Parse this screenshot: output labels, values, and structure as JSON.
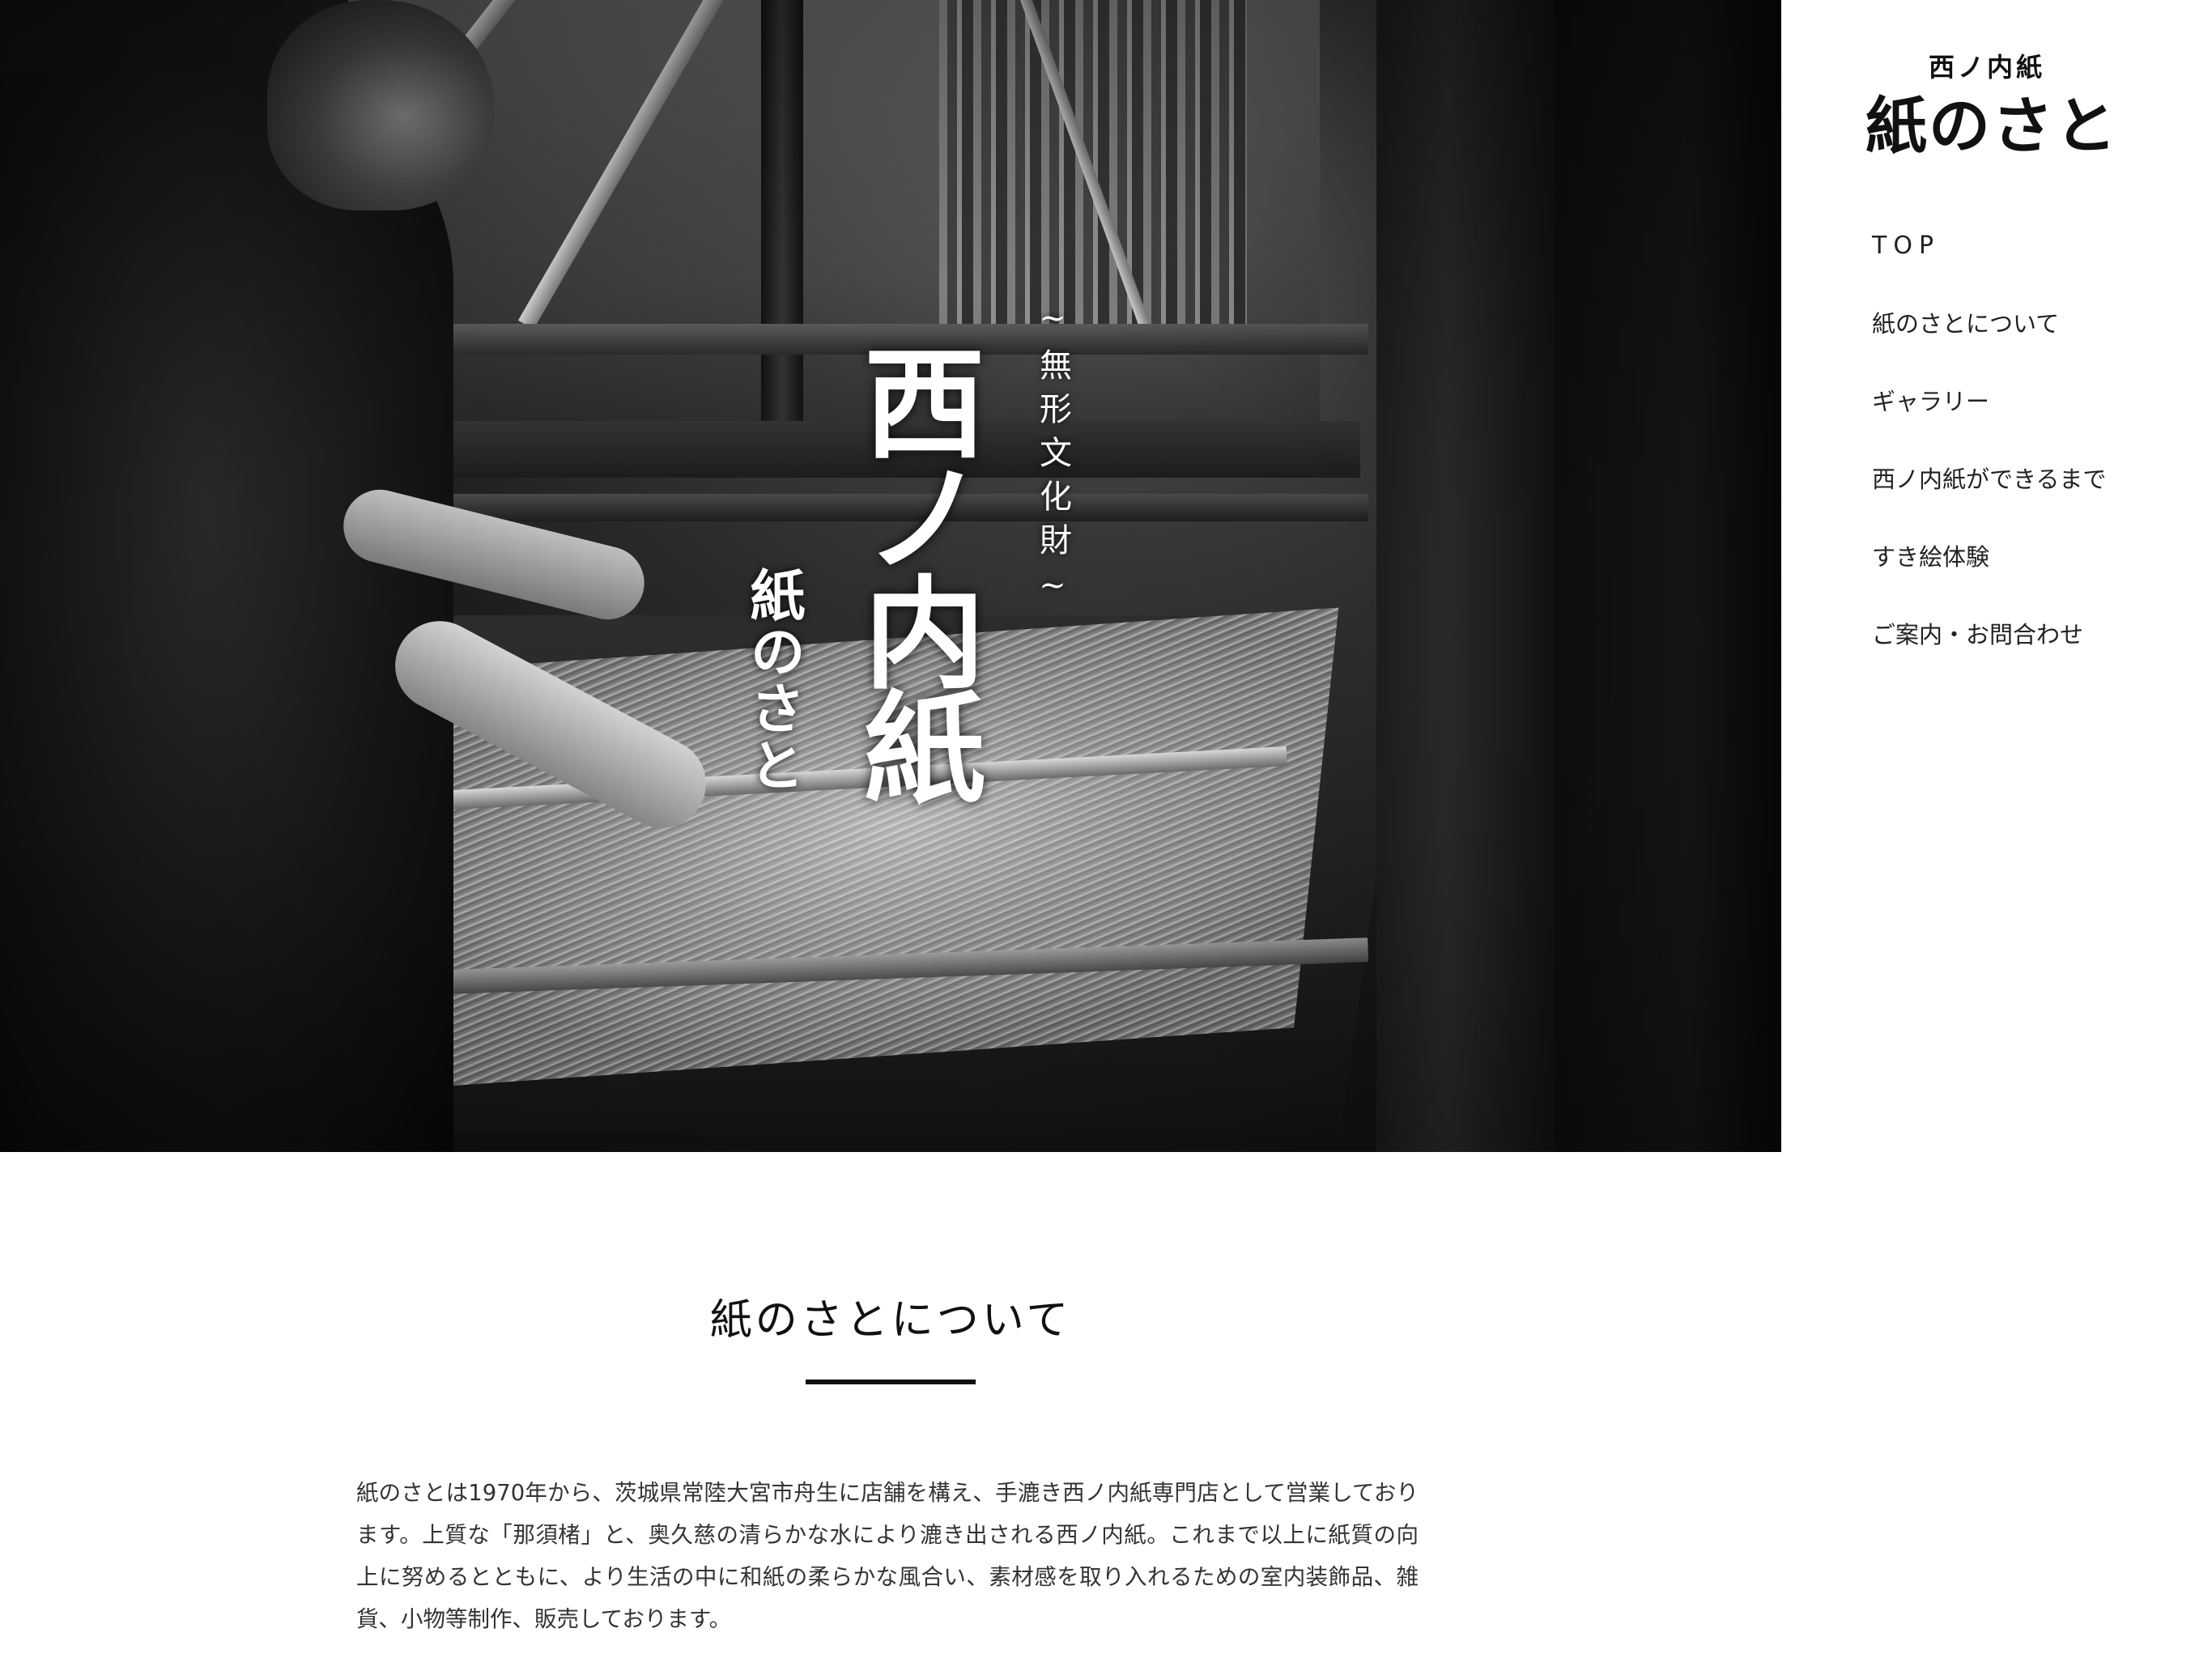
{
  "hero": {
    "subtitle": "~無形文化財~",
    "title": "西ノ内紙",
    "tagline": "紙のさと"
  },
  "logo": {
    "top_text": "西ノ内紙",
    "main_text": "紙のさと"
  },
  "nav": {
    "items": [
      {
        "label": "TOP"
      },
      {
        "label": "紙のさとについて"
      },
      {
        "label": "ギャラリー"
      },
      {
        "label": "西ノ内紙ができるまで"
      },
      {
        "label": "すき絵体験"
      },
      {
        "label": "ご案内・お問合わせ"
      }
    ]
  },
  "about": {
    "heading": "紙のさとについて",
    "body": "紙のさとは1970年から、茨城県常陸大宮市舟生に店舗を構え、手漉き西ノ内紙専門店として営業しております。上質な「那須楮」と、奥久慈の清らかな水により漉き出される西ノ内紙。これまで以上に紙質の向上に努めるとともに、より生活の中に和紙の柔らかな風合い、素材感を取り入れるための室内装飾品、雑貨、小物等制作、販売しております。"
  },
  "colors": {
    "text": "#222222",
    "background": "#ffffff",
    "rule": "#111111"
  }
}
